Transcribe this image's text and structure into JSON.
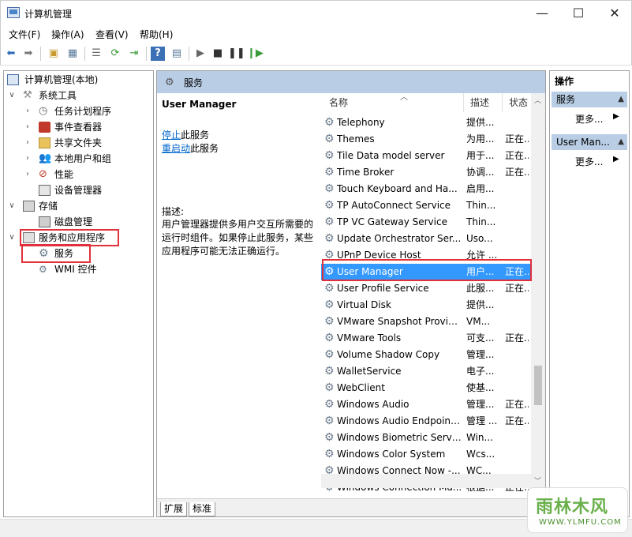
{
  "window": {
    "title": "计算机管理",
    "min": "—",
    "max": "☐",
    "close": "✕"
  },
  "menu": [
    "文件(F)",
    "操作(A)",
    "查看(V)",
    "帮助(H)"
  ],
  "tree": {
    "root": "计算机管理(本地)",
    "system_tools": "系统工具",
    "task_scheduler": "任务计划程序",
    "event_viewer": "事件查看器",
    "shared_folders": "共享文件夹",
    "local_users": "本地用户和组",
    "performance": "性能",
    "device_manager": "设备管理器",
    "storage": "存储",
    "disk_management": "磁盘管理",
    "services_apps": "服务和应用程序",
    "services": "服务",
    "wmi": "WMI 控件"
  },
  "middle": {
    "header": "服务",
    "selected_service": "User Manager",
    "stop_link": "停止",
    "stop_rest": "此服务",
    "restart_link": "重启动",
    "restart_rest": "此服务",
    "desc_label": "描述:",
    "desc_text": "用户管理器提供多用户交互所需要的运行时组件。如果停止此服务，某些应用程序可能无法正确运行。",
    "columns": {
      "name": "名称",
      "desc": "描述",
      "status": "状态"
    },
    "rows": [
      {
        "name": "Telephony",
        "desc": "提供...",
        "status": ""
      },
      {
        "name": "Themes",
        "desc": "为用...",
        "status": "正在..."
      },
      {
        "name": "Tile Data model server",
        "desc": "用于...",
        "status": "正在..."
      },
      {
        "name": "Time Broker",
        "desc": "协调...",
        "status": "正在..."
      },
      {
        "name": "Touch Keyboard and Ha...",
        "desc": "启用...",
        "status": ""
      },
      {
        "name": "TP AutoConnect Service",
        "desc": "Thin...",
        "status": ""
      },
      {
        "name": "TP VC Gateway Service",
        "desc": "Thin...",
        "status": ""
      },
      {
        "name": "Update Orchestrator Ser...",
        "desc": "Uso...",
        "status": ""
      },
      {
        "name": "UPnP Device Host",
        "desc": "允许 ...",
        "status": ""
      },
      {
        "name": "User Manager",
        "desc": "用户...",
        "status": "正在..."
      },
      {
        "name": "User Profile Service",
        "desc": "此服...",
        "status": "正在..."
      },
      {
        "name": "Virtual Disk",
        "desc": "提供...",
        "status": ""
      },
      {
        "name": "VMware Snapshot Provid...",
        "desc": "VM...",
        "status": ""
      },
      {
        "name": "VMware Tools",
        "desc": "可支...",
        "status": "正在..."
      },
      {
        "name": "Volume Shadow Copy",
        "desc": "管理...",
        "status": ""
      },
      {
        "name": "WalletService",
        "desc": "电子...",
        "status": ""
      },
      {
        "name": "WebClient",
        "desc": "使基...",
        "status": ""
      },
      {
        "name": "Windows Audio",
        "desc": "管理...",
        "status": "正在..."
      },
      {
        "name": "Windows Audio Endpoint...",
        "desc": "管理 ...",
        "status": "正在..."
      },
      {
        "name": "Windows Biometric Servi...",
        "desc": "Win...",
        "status": ""
      },
      {
        "name": "Windows Color System",
        "desc": "Wcs...",
        "status": ""
      },
      {
        "name": "Windows Connect Now -...",
        "desc": "WC...",
        "status": ""
      },
      {
        "name": "Windows Connection Ma...",
        "desc": "根据...",
        "status": "正在..."
      }
    ],
    "tabs": [
      "扩展",
      "标准"
    ]
  },
  "actions": {
    "title": "操作",
    "group1": "服务",
    "more1": "更多...",
    "group2": "User Man...",
    "more2": "更多..."
  },
  "watermark": {
    "main": "雨林木风",
    "sub": "WWW.YLMFU.COM"
  },
  "colors": {
    "header_bg": "#b9cde5",
    "selection": "#3399ff",
    "highlight_box": "#e0313b",
    "link": "#0066cc"
  }
}
